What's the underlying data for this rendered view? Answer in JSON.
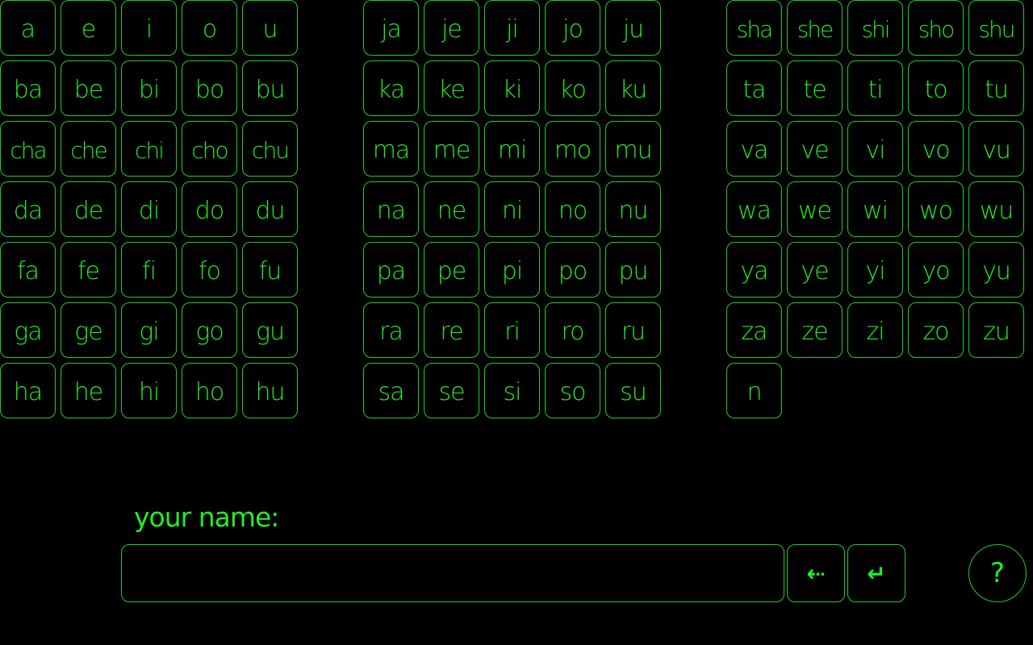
{
  "keyboard": {
    "blocks": [
      {
        "rows": [
          [
            "a",
            "e",
            "i",
            "o",
            "u"
          ],
          [
            "ba",
            "be",
            "bi",
            "bo",
            "bu"
          ],
          [
            "cha",
            "che",
            "chi",
            "cho",
            "chu"
          ],
          [
            "da",
            "de",
            "di",
            "do",
            "du"
          ],
          [
            "fa",
            "fe",
            "fi",
            "fo",
            "fu"
          ],
          [
            "ga",
            "ge",
            "gi",
            "go",
            "gu"
          ],
          [
            "ha",
            "he",
            "hi",
            "ho",
            "hu"
          ]
        ]
      },
      {
        "rows": [
          [
            "ja",
            "je",
            "ji",
            "jo",
            "ju"
          ],
          [
            "ka",
            "ke",
            "ki",
            "ko",
            "ku"
          ],
          [
            "ma",
            "me",
            "mi",
            "mo",
            "mu"
          ],
          [
            "na",
            "ne",
            "ni",
            "no",
            "nu"
          ],
          [
            "pa",
            "pe",
            "pi",
            "po",
            "pu"
          ],
          [
            "ra",
            "re",
            "ri",
            "ro",
            "ru"
          ],
          [
            "sa",
            "se",
            "si",
            "so",
            "su"
          ]
        ]
      },
      {
        "rows": [
          [
            "sha",
            "she",
            "shi",
            "sho",
            "shu"
          ],
          [
            "ta",
            "te",
            "ti",
            "to",
            "tu"
          ],
          [
            "va",
            "ve",
            "vi",
            "vo",
            "vu"
          ],
          [
            "wa",
            "we",
            "wi",
            "wo",
            "wu"
          ],
          [
            "ya",
            "ye",
            "yi",
            "yo",
            "yu"
          ],
          [
            "za",
            "ze",
            "zi",
            "zo",
            "zu"
          ],
          [
            "n"
          ]
        ]
      }
    ]
  },
  "name_entry": {
    "label": "your name:",
    "value": "",
    "placeholder": ""
  },
  "actions": {
    "backspace_label": "⇠",
    "enter_label": "↵",
    "help_label": "?"
  },
  "colors": {
    "background": "#000000",
    "accent": "#22ee22",
    "border": "#22cc22"
  }
}
